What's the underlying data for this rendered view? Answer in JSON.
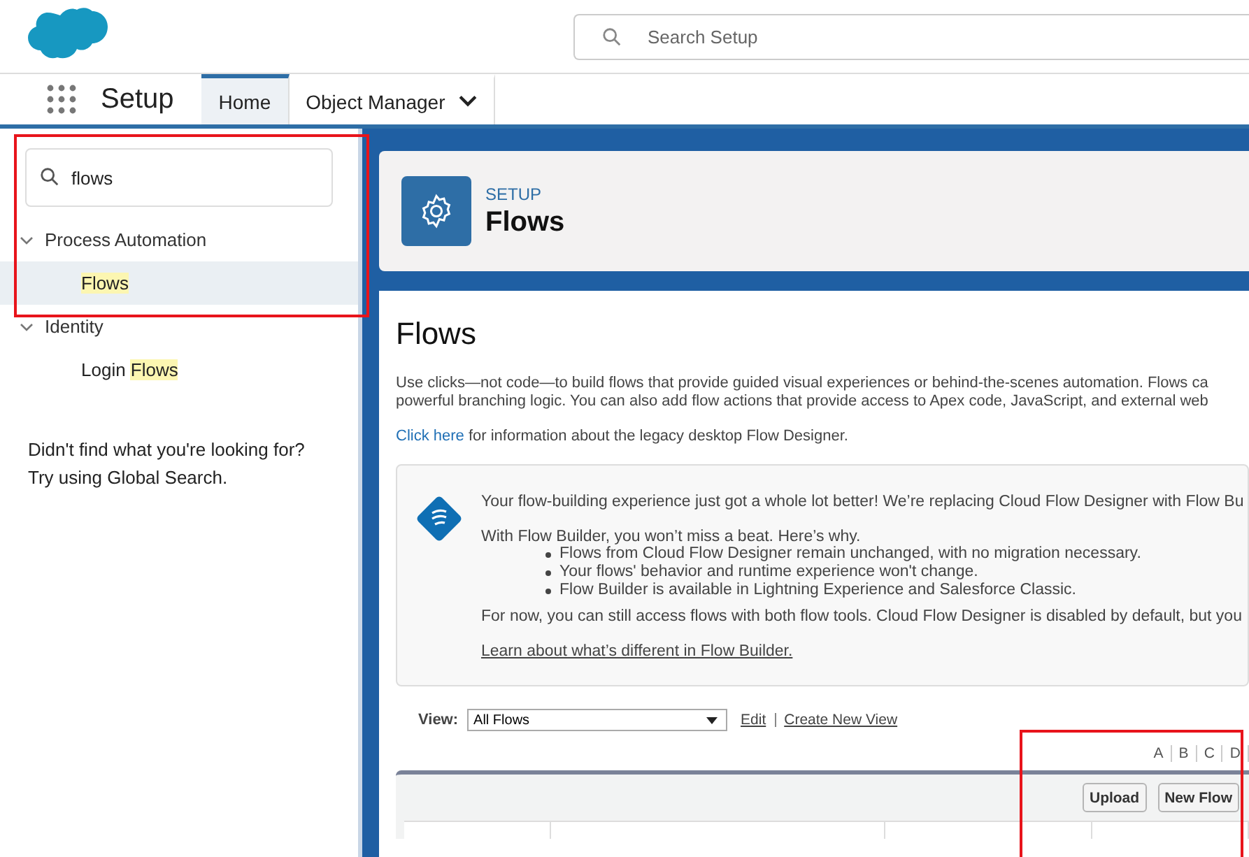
{
  "header": {
    "search": {
      "placeholder": "Search Setup"
    }
  },
  "nav": {
    "app_name": "Setup",
    "tabs": [
      {
        "label": "Home",
        "selected": true,
        "has_menu": false
      },
      {
        "label": "Object Manager",
        "selected": false,
        "has_menu": true
      }
    ]
  },
  "sidebar": {
    "search": {
      "value": "flows"
    },
    "tree": [
      {
        "label": "Process Automation",
        "expanded": true,
        "children": [
          {
            "match": "Flows",
            "selected": true
          }
        ]
      },
      {
        "label": "Identity",
        "expanded": true,
        "children": [
          {
            "prefix": "Login ",
            "match": "Flows",
            "selected": false
          }
        ]
      }
    ],
    "not_found": [
      "Didn't find what you're looking for?",
      "Try using Global Search."
    ]
  },
  "page_header": {
    "eyebrow": "SETUP",
    "title": "Flows"
  },
  "content": {
    "title": "Flows",
    "intro": [
      "Use clicks—not code—to build flows that provide guided visual experiences or behind-the-scenes automation. Flows ca",
      "powerful branching logic. You can also add flow actions that provide access to Apex code, JavaScript, and external web"
    ],
    "legacy": {
      "link": "Click here",
      "text": " for information about the legacy desktop Flow Designer."
    },
    "notice": {
      "headline": "Your flow-building experience just got a whole lot better! We’re replacing Cloud Flow Designer with Flow Bu",
      "lead": "With Flow Builder, you won’t miss a beat. Here’s why.",
      "bullets": [
        "Flows from Cloud Flow Designer remain unchanged, with no migration necessary.",
        "Your flows' behavior and runtime experience won't change.",
        "Flow Builder is available in Lightning Experience and Salesforce Classic."
      ],
      "footer": "For now, you can still access flows with both flow tools. Cloud Flow Designer is disabled by default, but you",
      "link": "Learn about what’s different in Flow Builder."
    },
    "view": {
      "label": "View:",
      "select": "All Flows",
      "links": [
        "Edit",
        "Create New View"
      ]
    },
    "alphabet": [
      "A",
      "B",
      "C",
      "D"
    ],
    "buttons": [
      "Upload",
      "New Flow"
    ]
  }
}
